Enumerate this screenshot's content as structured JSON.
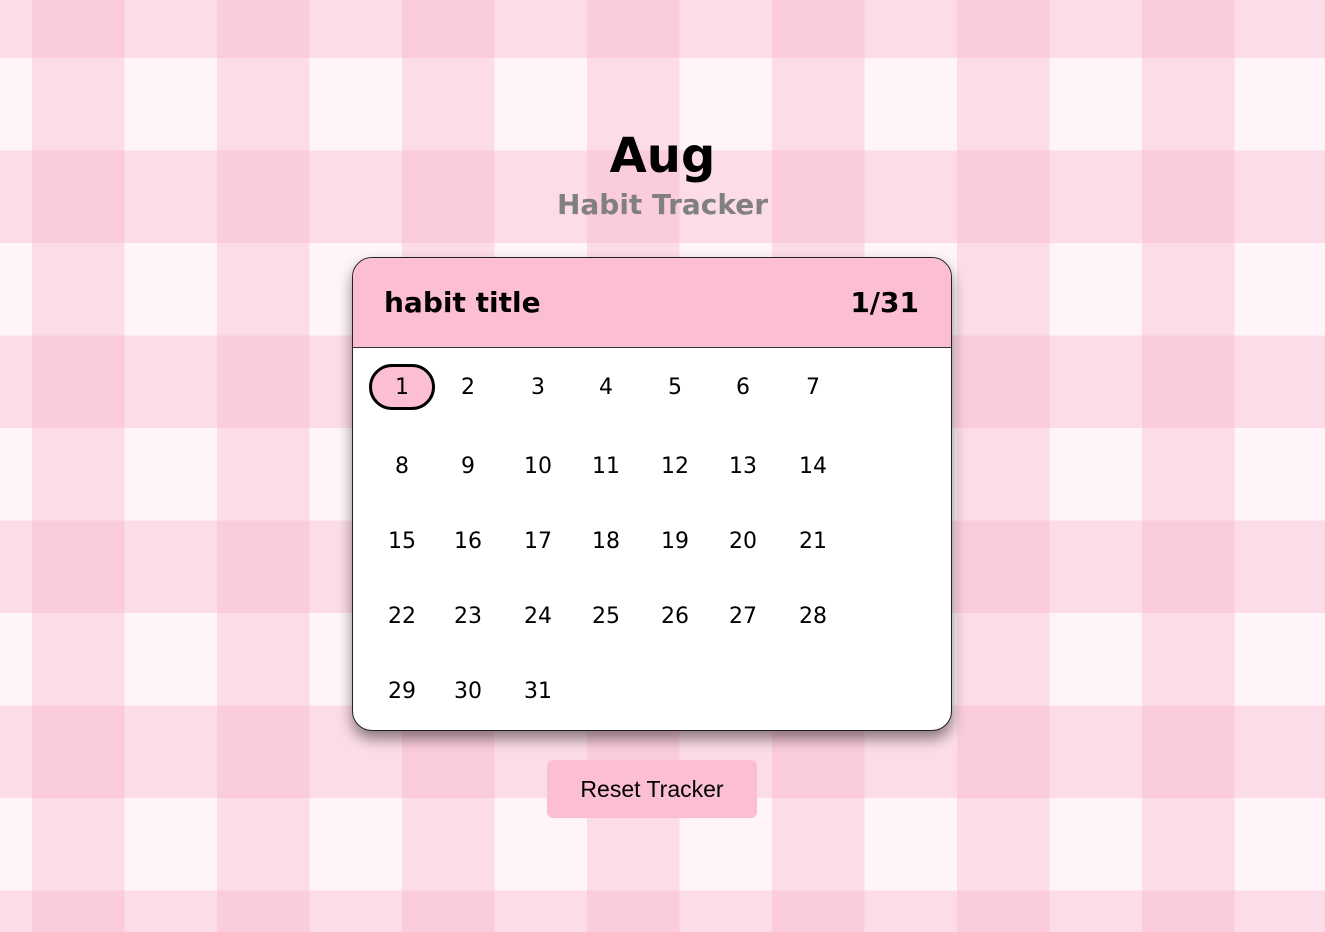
{
  "header": {
    "month": "Aug",
    "subtitle": "Habit Tracker"
  },
  "tracker": {
    "habit_title": "habit title",
    "progress_text": "1/31",
    "days": [
      {
        "label": "1",
        "checked": true
      },
      {
        "label": "2",
        "checked": false
      },
      {
        "label": "3",
        "checked": false
      },
      {
        "label": "4",
        "checked": false
      },
      {
        "label": "5",
        "checked": false
      },
      {
        "label": "6",
        "checked": false
      },
      {
        "label": "7",
        "checked": false
      },
      {
        "label": "8",
        "checked": false
      },
      {
        "label": "9",
        "checked": false
      },
      {
        "label": "10",
        "checked": false
      },
      {
        "label": "11",
        "checked": false
      },
      {
        "label": "12",
        "checked": false
      },
      {
        "label": "13",
        "checked": false
      },
      {
        "label": "14",
        "checked": false
      },
      {
        "label": "15",
        "checked": false
      },
      {
        "label": "16",
        "checked": false
      },
      {
        "label": "17",
        "checked": false
      },
      {
        "label": "18",
        "checked": false
      },
      {
        "label": "19",
        "checked": false
      },
      {
        "label": "20",
        "checked": false
      },
      {
        "label": "21",
        "checked": false
      },
      {
        "label": "22",
        "checked": false
      },
      {
        "label": "23",
        "checked": false
      },
      {
        "label": "24",
        "checked": false
      },
      {
        "label": "25",
        "checked": false
      },
      {
        "label": "26",
        "checked": false
      },
      {
        "label": "27",
        "checked": false
      },
      {
        "label": "28",
        "checked": false
      },
      {
        "label": "29",
        "checked": false
      },
      {
        "label": "30",
        "checked": false
      },
      {
        "label": "31",
        "checked": false
      }
    ]
  },
  "actions": {
    "reset_label": "Reset Tracker"
  },
  "colors": {
    "accent_pink": "#fcbed4",
    "subtitle_gray": "#808080"
  }
}
